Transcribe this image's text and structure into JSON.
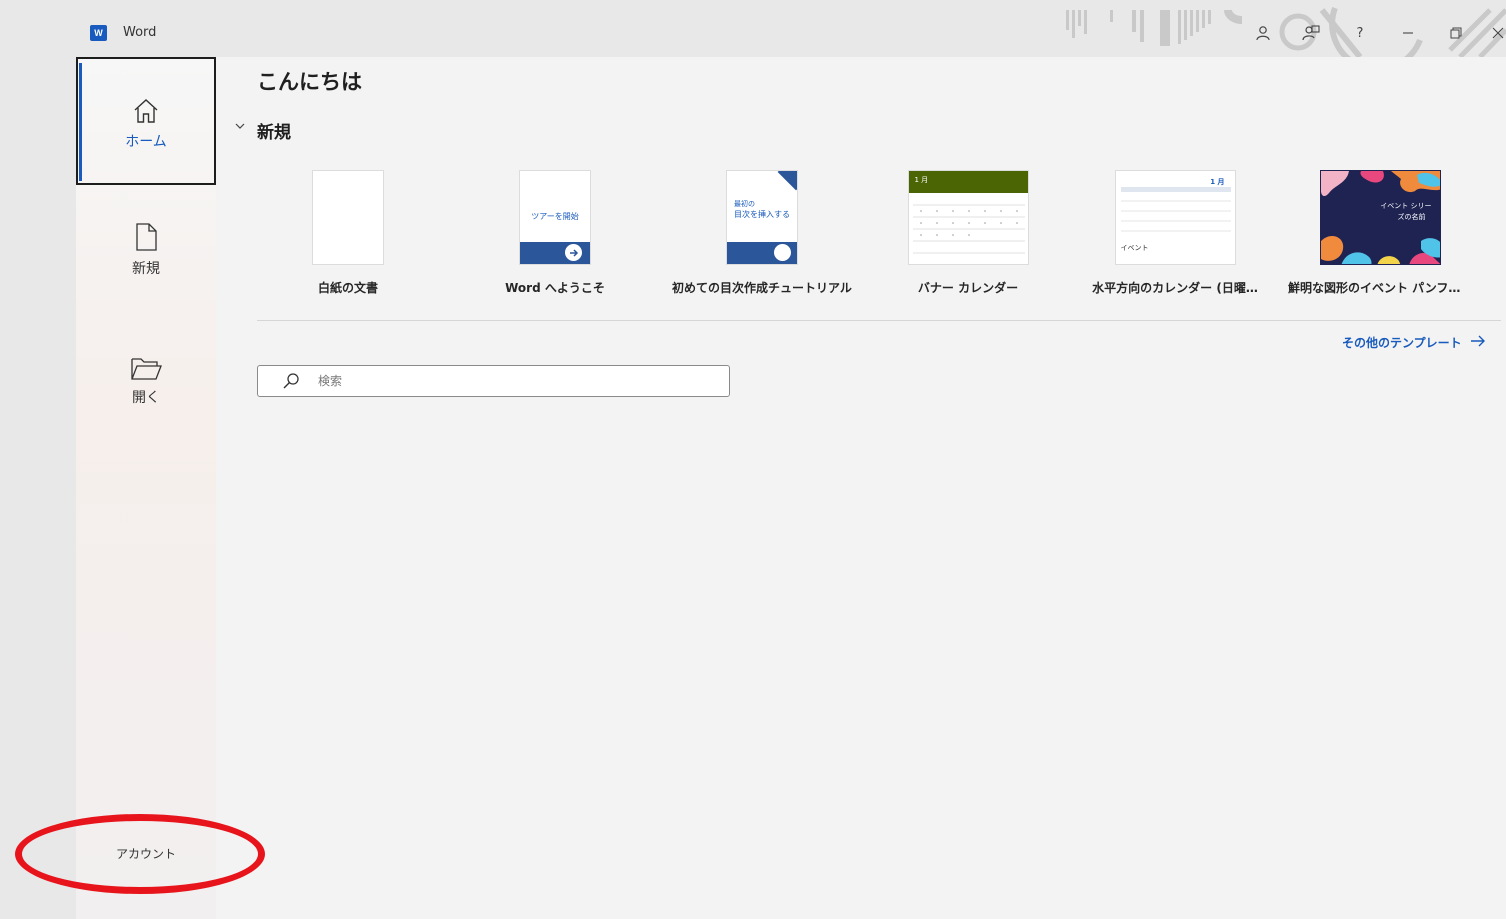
{
  "titlebar": {
    "app_title": "Word",
    "logo_letter": "W"
  },
  "sidebar": {
    "items": [
      {
        "label": "ホーム",
        "icon": "home-icon",
        "active": true
      },
      {
        "label": "新規",
        "icon": "new-document-icon",
        "active": false
      },
      {
        "label": "開く",
        "icon": "open-folder-icon",
        "active": false
      }
    ],
    "bottom": {
      "account": "アカウント"
    }
  },
  "main": {
    "greeting": "こんにちは",
    "new_section": {
      "title": "新規",
      "templates": [
        {
          "label": "白紙の文書"
        },
        {
          "label": "Word へようこそ",
          "thumb_text": "ツアーを開始"
        },
        {
          "label": "初めての目次作成チュートリアル",
          "thumb_text_1": "最初の",
          "thumb_text_2": "目次を挿入する"
        },
        {
          "label": "バナー カレンダー",
          "thumb_text": "1 月"
        },
        {
          "label": "水平方向のカレンダー (日曜…",
          "thumb_text": "1 月",
          "thumb_text_2": "イベント"
        },
        {
          "label": "鮮明な図形のイベント パンフレ…",
          "thumb_text_1": "イベント シリー",
          "thumb_text_2": "ズの名前"
        }
      ],
      "more_templates": "その他のテンプレート"
    },
    "search": {
      "placeholder": "検索"
    }
  },
  "colors": {
    "accent": "#185abd",
    "annotation": "#e8141c",
    "banner_green": "#4b6404"
  }
}
